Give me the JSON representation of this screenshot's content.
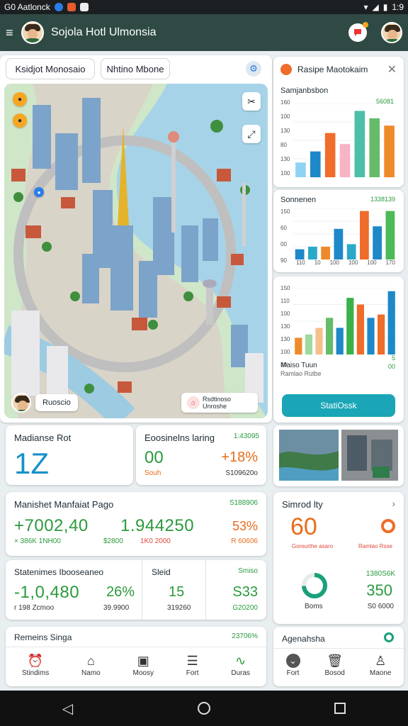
{
  "status": {
    "left_text": "G0 Aatlonck",
    "time": "1:9"
  },
  "appbar": {
    "title": "Sojola Hotl Ulmonsia"
  },
  "chips": {
    "left": "Ksidjot Monosaio",
    "right": "Nhtino Mbone"
  },
  "map": {
    "pill_left": "Ruoscio",
    "pill_right": "Rsdtinoso Unroshe"
  },
  "right_panel": {
    "header_title": "Rasipe Maotokaim",
    "chart1_subtitle": "Samjanbsbon",
    "chart1_value": "56081",
    "chart1_ticks": [
      "160",
      "100",
      "130",
      "80",
      "130",
      "100"
    ],
    "chart2_title": "Sonnenen",
    "chart2_value": "1338139",
    "chart2_ticks": [
      "150",
      "60",
      "00",
      "90"
    ],
    "chart2_xticks": [
      "110",
      "10",
      "100",
      "100",
      "100",
      "170"
    ],
    "chart3_ticks": [
      "150",
      "110",
      "100",
      "130",
      "130",
      "100",
      "30"
    ],
    "chart3_legend1": "Maiso Tuun",
    "chart3_legend2": "Ramlao Rutbe",
    "chart3_val1": "5",
    "chart3_val2": "00",
    "button": "StatiOssk"
  },
  "chart_data": [
    {
      "type": "bar",
      "values": [
        20,
        35,
        60,
        45,
        90,
        80,
        70
      ],
      "colors": [
        "#8fd3f3",
        "#1e88c8",
        "#ef6c2a",
        "#f7b4c4",
        "#4cbfa6",
        "#66bb6a",
        "#ef8a2a"
      ]
    },
    {
      "type": "bar",
      "values": [
        20,
        25,
        25,
        60,
        30,
        95,
        65,
        95
      ],
      "colors": [
        "#1e88c8",
        "#2aa8c8",
        "#ef8a2a",
        "#1e88c8",
        "#2aa8c8",
        "#ef6c2a",
        "#1e88c8",
        "#4cba56"
      ]
    },
    {
      "type": "bar",
      "values": [
        25,
        30,
        40,
        55,
        40,
        85,
        75,
        55,
        60,
        95
      ],
      "colors": [
        "#ef8a2a",
        "#9ed9a0",
        "#f7c08a",
        "#66bb6a",
        "#1e88c8",
        "#39b24a",
        "#ef6c2a",
        "#1e88c8",
        "#ef6c2a",
        "#1e88c8"
      ]
    }
  ],
  "kpi1": {
    "label": "Madianse Rot",
    "value": "1Z"
  },
  "kpi2": {
    "label": "Eoosinelns laring",
    "top_right": "1:43095",
    "value": "00",
    "delta": "+18%",
    "sub_left": "Souh",
    "sub_right": "S109620o"
  },
  "mkt": {
    "label": "Manishet Manfaiat Pago",
    "top_right": "S188906",
    "v1": "+7002,40",
    "v2": "1.944250",
    "v3": "53%",
    "s1": "× 386K 1NH00",
    "s2": "$2800",
    "s3": "1K0 2000",
    "s4": "R 60606"
  },
  "rates": {
    "label": "Statenimes Ibooseaneo",
    "v1": "-1,0,480",
    "v2": "26%",
    "s1": "r 198 Zcmoo",
    "s2": "39.9900",
    "col_label": "Sleid",
    "col_val": "15",
    "col_sub": "319260",
    "right_label": "Smiso",
    "right_val": "S33",
    "right_sub": "G20200"
  },
  "simplify": {
    "label": "Simrod lty",
    "v": "60",
    "s1": "Goreurthe asaro",
    "s2": "Ramlao Rsse",
    "top_right": "1380S6K",
    "v2": "350",
    "sub1": "Boms",
    "sub2": "S0 6000"
  },
  "remains": {
    "label": "Remeins Singa",
    "value": "23706%"
  },
  "bottom_tabs": [
    "Stindims",
    "Namo",
    "Moosy",
    "Fort",
    "Duras"
  ],
  "right_card": {
    "label": "Agenahsha"
  },
  "right_tabs": [
    "Fort",
    "Bosod",
    "Maone"
  ],
  "icons": [
    "menu-icon",
    "notification-icon",
    "settings-icon",
    "search-icon",
    "close-icon",
    "back-icon",
    "home-icon",
    "recent-icon"
  ]
}
